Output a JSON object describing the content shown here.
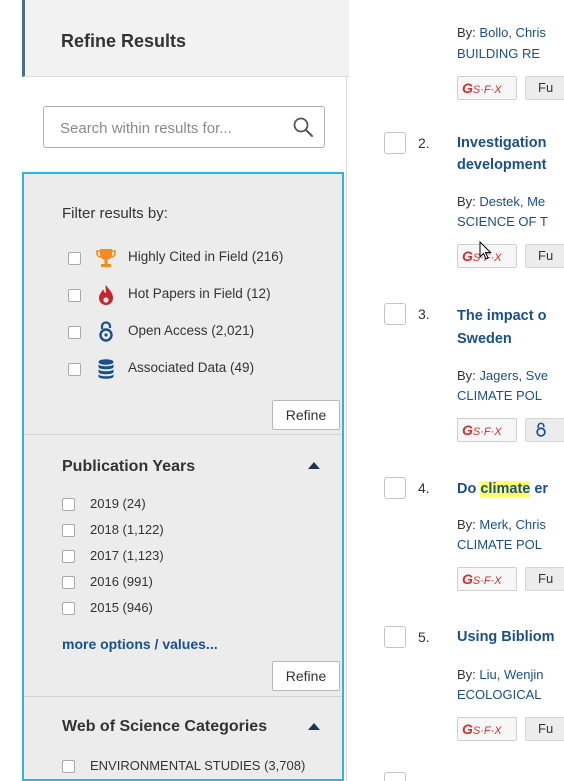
{
  "sidebar": {
    "header_title": "Refine Results",
    "search_placeholder": "Search within results for...",
    "filter_heading": "Filter results by:",
    "filters": [
      {
        "label": "Highly Cited in Field (216)",
        "icon": "trophy-icon",
        "color": "#f5891f"
      },
      {
        "label": "Hot Papers in Field (12)",
        "icon": "flame-icon",
        "color": "#c1272d"
      },
      {
        "label": "Open Access (2,021)",
        "icon": "open-access-icon",
        "color": "#1a4f8c"
      },
      {
        "label": "Associated Data (49)",
        "icon": "database-icon",
        "color": "#1a4f8c"
      }
    ],
    "refine_label": "Refine",
    "pub_years": {
      "heading": "Publication Years",
      "items": [
        "2019 (24)",
        "2018 (1,122)",
        "2017 (1,123)",
        "2016 (991)",
        "2015 (946)"
      ],
      "more": "more options / values..."
    },
    "wos": {
      "heading": "Web of Science Categories",
      "items": [
        "ENVIRONMENTAL STUDIES (3,708)"
      ]
    },
    "accent_color": "#29b6e6"
  },
  "results": [
    {
      "num": "",
      "title": [],
      "authors": "Bollo, Chris",
      "source": "BUILDING RE",
      "action": "Fu"
    },
    {
      "num": "2.",
      "title": [
        "Investigation",
        "development"
      ],
      "authors": "Destek, Me",
      "source": "SCIENCE OF T",
      "action": "Fu"
    },
    {
      "num": "3.",
      "title": [
        "The impact o",
        "Sweden"
      ],
      "authors": "Jagers, Sve",
      "source": "CLIMATE POL",
      "action": ""
    },
    {
      "num": "4.",
      "title_pre": "Do ",
      "title_hl": "climate",
      "title_post": " er",
      "authors": "Merk, Chris",
      "source": "CLIMATE POL",
      "action": "Fu"
    },
    {
      "num": "5.",
      "title": [
        "Using Bibliom"
      ],
      "authors": "Liu, Wenjin",
      "source": "ECOLOGICAL",
      "action": "Fu"
    }
  ],
  "by_label": "By:",
  "sfx_label": "S·F·X"
}
